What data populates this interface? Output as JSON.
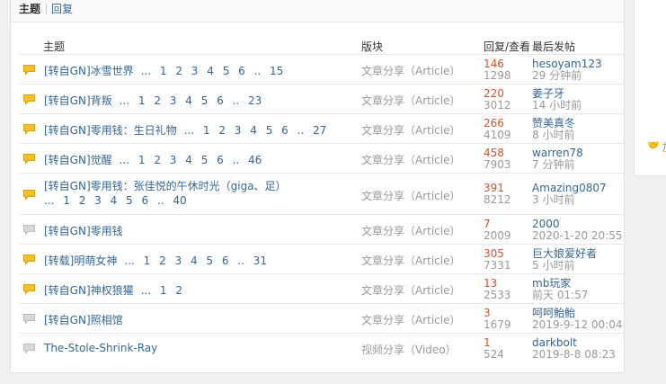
{
  "tabs": {
    "active": "主题",
    "other": "回复"
  },
  "columns": {
    "topic": "主题",
    "category": "版块",
    "stats": "回复/查看",
    "last_post": "最后发帖"
  },
  "rows": [
    {
      "title": "[转自GN]冰雪世界",
      "pages": "... 1 2 3 4 5 6 .. 15",
      "category": "文章分享（Article）",
      "replies": "146",
      "views": "1298",
      "last_user": "hesoyam123",
      "last_time": "29 分钟前",
      "icon": "speech-bubble-hot-icon"
    },
    {
      "title": "[转自GN]背叛",
      "pages": "... 1 2 3 4 5 6 .. 23",
      "category": "文章分享（Article）",
      "replies": "220",
      "views": "3012",
      "last_user": "姜子牙",
      "last_time": "14 小时前",
      "icon": "speech-bubble-hot-icon"
    },
    {
      "title": "[转自GN]零用钱：生日礼物",
      "pages": "... 1 2 3 4 5 6 .. 27",
      "category": "文章分享（Article）",
      "replies": "266",
      "views": "4109",
      "last_user": "赞美真冬",
      "last_time": "8 小时前",
      "icon": "speech-bubble-hot-icon"
    },
    {
      "title": "[转自GN]觉醒",
      "pages": "... 1 2 3 4 5 6 .. 46",
      "category": "文章分享（Article）",
      "replies": "458",
      "views": "7903",
      "last_user": "warren78",
      "last_time": "7 分钟前",
      "icon": "speech-bubble-hot-icon"
    },
    {
      "title": "[转自GN]零用钱：张佳悦的午休时光（giga、足）",
      "pages": "... 1 2 3 4 5 6 .. 40",
      "category": "文章分享（Article）",
      "replies": "391",
      "views": "8212",
      "last_user": "Amazing0807",
      "last_time": "3 小时前",
      "icon": "speech-bubble-hot-icon"
    },
    {
      "title": "[转自GN]零用钱",
      "pages": "",
      "category": "文章分享（Article）",
      "replies": "7",
      "views": "2009",
      "last_user": "2000",
      "last_time": "2020-1-20 20:55",
      "icon": "speech-bubble-icon"
    },
    {
      "title": "[转载]明萌女神",
      "pages": "... 1 2 3 4 5 6 .. 31",
      "category": "文章分享（Article）",
      "replies": "305",
      "views": "7331",
      "last_user": "巨大娘爱好者",
      "last_time": "5 小时前",
      "icon": "speech-bubble-hot-icon"
    },
    {
      "title": "[转自GN]神权狼獾",
      "pages": "... 1 2",
      "category": "文章分享（Article）",
      "replies": "13",
      "views": "2533",
      "last_user": "mb玩家",
      "last_time": "前天 01:57",
      "icon": "speech-bubble-hot-icon"
    },
    {
      "title": "[转自GN]照相馆",
      "pages": "",
      "category": "文章分享（Article）",
      "replies": "3",
      "views": "1679",
      "last_user": "呵呵鲐鲐",
      "last_time": "2019-9-12 00:04",
      "icon": "speech-bubble-icon"
    },
    {
      "title": "The-Stole-Shrink-Ray",
      "pages": "",
      "category": "视频分享（Video）",
      "replies": "1",
      "views": "524",
      "last_user": "darkbolt",
      "last_time": "2019-8-8 08:23",
      "icon": "speech-bubble-icon"
    }
  ],
  "sidebar": {
    "label": "加"
  },
  "colors": {
    "link": "#336699",
    "replies": "#d9502a",
    "muted": "#999999",
    "hot_icon": "#f6c12a",
    "plain_icon": "#d8d8d8"
  }
}
